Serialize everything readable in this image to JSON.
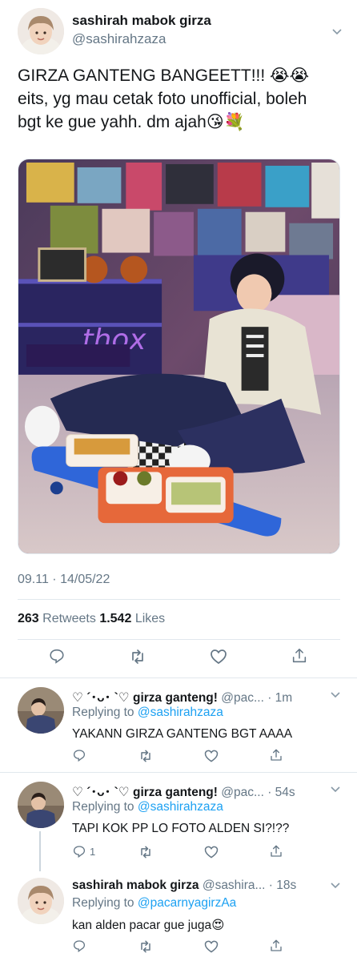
{
  "main_tweet": {
    "display_name": "sashirah mabok girza",
    "handle": "@sashirahzaza",
    "text_line1": "GIRZA GANTENG BANGEETT!!! 😭😭",
    "text_line2": "eits, yg mau cetak foto unofficial, boleh",
    "text_line3": "bgt ke gue yahh. dm ajah😘💐",
    "timestamp": "09.11 · 14/05/22",
    "retweets_count": "263",
    "retweets_label": "Retweets",
    "likes_count": "1.542",
    "likes_label": "Likes"
  },
  "replies": [
    {
      "display_name": "♡ ´･ᴗ･ `♡ girza ganteng!",
      "handle": "@pac...",
      "time": "· 1m",
      "replying_prefix": "Replying to",
      "replying_to": "@sashirahzaza",
      "text": "YAKANN GIRZA GANTENG BGT AAAA",
      "reply_count": ""
    },
    {
      "display_name": "♡ ´･ᴗ･ `♡ girza ganteng!",
      "handle": "@pac...",
      "time": "· 54s",
      "replying_prefix": "Replying to",
      "replying_to": "@sashirahzaza",
      "text": "TAPI KOK PP LO FOTO ALDEN SI?!??",
      "reply_count": "1"
    },
    {
      "display_name": "sashirah mabok girza",
      "handle": "@sashira...",
      "time": "· 18s",
      "replying_prefix": "Replying to",
      "replying_to": "@pacarnyagirzAa",
      "text": "kan alden pacar gue juga😍",
      "reply_count": ""
    }
  ],
  "colors": {
    "link": "#1da1f2",
    "muted": "#657786",
    "divider": "#e1e8ed",
    "text": "#14171a"
  },
  "icons": [
    "reply-icon",
    "retweet-icon",
    "like-icon",
    "share-icon",
    "chevron-down-icon"
  ]
}
